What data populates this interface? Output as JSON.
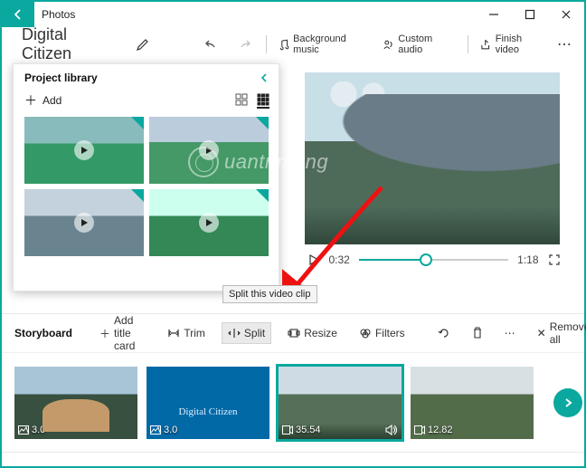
{
  "window": {
    "app_title": "Photos"
  },
  "toolbar": {
    "project_name": "Digital Citizen",
    "bg_music": "Background music",
    "custom_audio": "Custom audio",
    "finish_video": "Finish video"
  },
  "library": {
    "title": "Project library",
    "add_label": "Add"
  },
  "player": {
    "current_time": "0:32",
    "total_time": "1:18"
  },
  "tooltip": {
    "split": "Split this video clip"
  },
  "storyboard": {
    "title": "Storyboard",
    "add_title_card": "Add title card",
    "trim": "Trim",
    "split": "Split",
    "resize": "Resize",
    "filters": "Filters",
    "remove_all": "Remove all",
    "clips": [
      {
        "duration": "3.0",
        "kind": "image"
      },
      {
        "duration": "3.0",
        "kind": "image",
        "caption": "Digital Citizen"
      },
      {
        "duration": "35.54",
        "kind": "video",
        "selected": true
      },
      {
        "duration": "12.82",
        "kind": "video"
      }
    ]
  },
  "watermark": "uantrimang"
}
